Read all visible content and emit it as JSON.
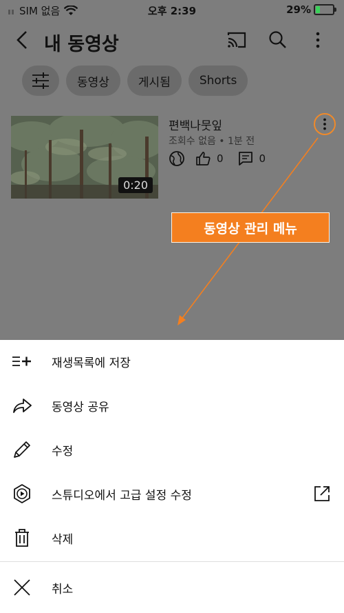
{
  "status_bar": {
    "carrier": "SIM 없음",
    "time": "오후 2:39",
    "battery_percent": "29%",
    "battery_level": 0.29
  },
  "app_bar": {
    "title": "내 동영상"
  },
  "filters": {
    "chips": [
      "동영상",
      "게시됨",
      "Shorts"
    ]
  },
  "video": {
    "title": "편백나뭇잎",
    "meta": "조회수 없음 • 1분 전",
    "likes": "0",
    "comments": "0",
    "duration": "0:20"
  },
  "callout": {
    "text": "동영상 관리 메뉴"
  },
  "sheet": {
    "items": [
      {
        "label": "재생목록에 저장",
        "icon": "playlist-add-icon"
      },
      {
        "label": "동영상 공유",
        "icon": "share-icon"
      },
      {
        "label": "수정",
        "icon": "pencil-icon"
      },
      {
        "label": "스튜디오에서 고급 설정 수정",
        "icon": "studio-icon"
      },
      {
        "label": "삭제",
        "icon": "trash-icon"
      }
    ],
    "cancel": {
      "label": "취소",
      "icon": "close-icon"
    }
  },
  "colors": {
    "accent": "#f47f1f",
    "overlay": "#7d7d7d"
  }
}
